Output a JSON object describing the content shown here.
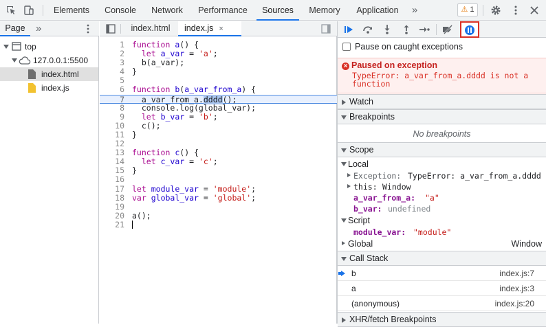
{
  "topbar": {
    "tabs": [
      {
        "label": "Elements"
      },
      {
        "label": "Console"
      },
      {
        "label": "Network"
      },
      {
        "label": "Performance"
      },
      {
        "label": "Sources",
        "active": true
      },
      {
        "label": "Memory"
      },
      {
        "label": "Application"
      }
    ],
    "more_label": "»",
    "warnings_count": "1"
  },
  "navigator": {
    "tab_label": "Page",
    "more_label": "»",
    "tree": [
      {
        "label": "top",
        "icon": "frame-icon"
      },
      {
        "label": "127.0.0.1:5500",
        "icon": "cloud-icon"
      },
      {
        "label": "index.html",
        "icon": "file-icon",
        "selected": true
      },
      {
        "label": "index.js",
        "icon": "js-file-icon"
      }
    ]
  },
  "editor": {
    "tabs": [
      {
        "label": "index.html"
      },
      {
        "label": "index.js",
        "active": true,
        "close": "×"
      }
    ],
    "execution_line": 7,
    "lines": [
      {
        "n": "1",
        "text": "function a() {"
      },
      {
        "n": "2",
        "text": "  let a_var = 'a';"
      },
      {
        "n": "3",
        "text": "  b(a_var);"
      },
      {
        "n": "4",
        "text": "}"
      },
      {
        "n": "5",
        "text": ""
      },
      {
        "n": "6",
        "text": "function b(a_var_from_a) {"
      },
      {
        "n": "7",
        "text": "  a_var_from_a.dddd();"
      },
      {
        "n": "8",
        "text": "  console.log(global_var);"
      },
      {
        "n": "9",
        "text": "  let b_var = 'b';"
      },
      {
        "n": "10",
        "text": "  c();"
      },
      {
        "n": "11",
        "text": "}"
      },
      {
        "n": "12",
        "text": ""
      },
      {
        "n": "13",
        "text": "function c() {"
      },
      {
        "n": "14",
        "text": "  let c_var = 'c';"
      },
      {
        "n": "15",
        "text": "}"
      },
      {
        "n": "16",
        "text": ""
      },
      {
        "n": "17",
        "text": "let module_var = 'module';"
      },
      {
        "n": "18",
        "text": "var global_var = 'global';"
      },
      {
        "n": "19",
        "text": ""
      },
      {
        "n": "20",
        "text": "a();"
      },
      {
        "n": "21",
        "text": ""
      }
    ]
  },
  "debugger": {
    "pause_caught_label": "Pause on caught exceptions",
    "exception": {
      "title": "Paused on exception",
      "message": "TypeError: a_var_from_a.dddd is not a function"
    },
    "sections": {
      "watch": "Watch",
      "breakpoints": "Breakpoints",
      "no_breakpoints": "No breakpoints",
      "scope": "Scope",
      "call_stack": "Call Stack",
      "xhr": "XHR/fetch Breakpoints"
    },
    "scope": {
      "local_label": "Local",
      "exception_key": "Exception:",
      "exception_val": "TypeError: a_var_from_a.dddd",
      "this_key": "this:",
      "this_val": "Window",
      "a_var_key": "a_var_from_a:",
      "a_var_val": "\"a\"",
      "b_var_key": "b_var:",
      "b_var_val": "undefined",
      "script_label": "Script",
      "module_key": "module_var:",
      "module_val": "\"module\"",
      "global_label": "Global",
      "global_val": "Window"
    },
    "call_stack": [
      {
        "fn": "b",
        "loc": "index.js:7",
        "current": true
      },
      {
        "fn": "a",
        "loc": "index.js:3"
      },
      {
        "fn": "(anonymous)",
        "loc": "index.js:20"
      }
    ]
  }
}
